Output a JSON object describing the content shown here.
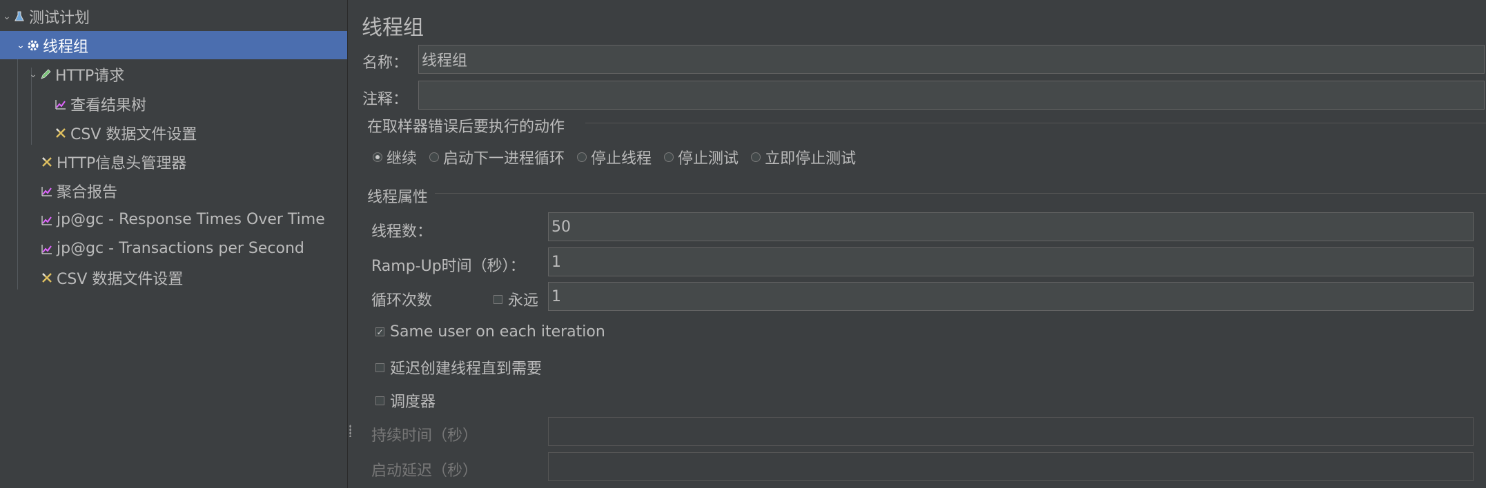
{
  "tree": {
    "items": [
      {
        "label": "测试计划",
        "icon": "flask-icon"
      },
      {
        "label": "线程组",
        "icon": "gear-icon"
      },
      {
        "label": "HTTP请求",
        "icon": "pen-icon"
      },
      {
        "label": "查看结果树",
        "icon": "graph-icon"
      },
      {
        "label": "CSV 数据文件设置",
        "icon": "tools-icon"
      },
      {
        "label": "HTTP信息头管理器",
        "icon": "tools-icon"
      },
      {
        "label": "聚合报告",
        "icon": "graph-icon"
      },
      {
        "label": "jp@gc - Response Times Over Time",
        "icon": "graph-icon"
      },
      {
        "label": "jp@gc - Transactions per Second",
        "icon": "graph-icon"
      },
      {
        "label": "CSV 数据文件设置",
        "icon": "tools-icon"
      }
    ]
  },
  "panel": {
    "title": "线程组",
    "name_label": "名称：",
    "name_value": "线程组",
    "comment_label": "注释：",
    "comment_value": "",
    "error_section": {
      "title": "在取样器错误后要执行的动作",
      "options": [
        "继续",
        "启动下一进程循环",
        "停止线程",
        "停止测试",
        "立即停止测试"
      ],
      "selected": "继续"
    },
    "thread_props": {
      "title": "线程属性",
      "threads_label": "线程数：",
      "threads_value": "50",
      "rampup_label": "Ramp-Up时间（秒）：",
      "rampup_value": "1",
      "loop_label": "循环次数",
      "forever_label": "永远",
      "forever_checked": false,
      "loop_value": "1",
      "same_user_label": "Same user on each iteration",
      "same_user_checked": true,
      "delay_label": "延迟创建线程直到需要",
      "delay_checked": false,
      "scheduler_label": "调度器",
      "scheduler_checked": false,
      "duration_label": "持续时间（秒）",
      "duration_value": "",
      "startup_delay_label": "启动延迟（秒）",
      "startup_delay_value": ""
    }
  },
  "colors": {
    "background": "#3c3f41",
    "selection": "#4b6eaf",
    "field": "#45494a",
    "text": "#bbbbbb"
  }
}
